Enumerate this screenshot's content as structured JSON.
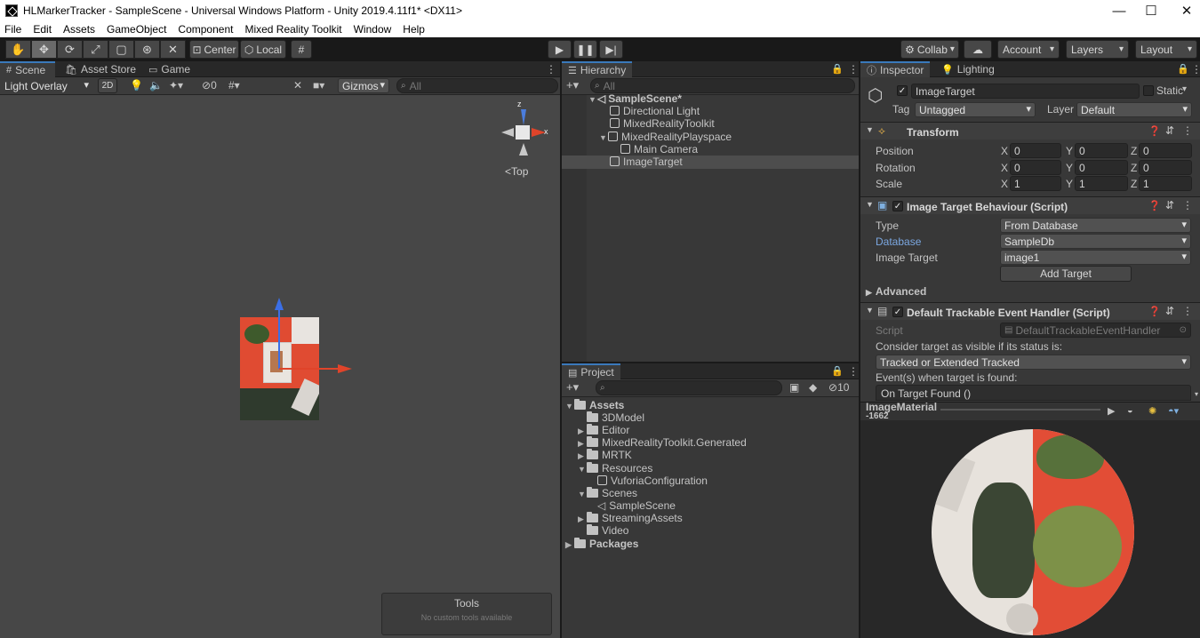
{
  "window": {
    "title": "HLMarkerTracker - SampleScene - Universal Windows Platform - Unity 2019.4.11f1* <DX11>",
    "minimize": "—",
    "maximize": "☐",
    "close": "✕"
  },
  "menu": [
    "File",
    "Edit",
    "Assets",
    "GameObject",
    "Component",
    "Mixed Reality Toolkit",
    "Window",
    "Help"
  ],
  "toolbar": {
    "center_label": "Center",
    "local_label": "Local",
    "collab_label": "Collab",
    "account_label": "Account",
    "layers_label": "Layers",
    "layout_label": "Layout"
  },
  "scene": {
    "tabs": [
      "Scene",
      "Asset Store",
      "Game"
    ],
    "light_overlay": "Light Overlay",
    "mode_2d": "2D",
    "hidden_count": "0",
    "gizmos_label": "Gizmos",
    "search_placeholder": "All",
    "gizmo_y": "z",
    "gizmo_x": "x",
    "view_label": "Top",
    "tools_title": "Tools",
    "tools_subtitle": "No custom tools available"
  },
  "hierarchy": {
    "tab": "Hierarchy",
    "search_placeholder": "All",
    "scene_name": "SampleScene*",
    "items": [
      "Directional Light",
      "MixedRealityToolkit",
      "MixedRealityPlayspace",
      "Main Camera",
      "ImageTarget"
    ]
  },
  "project": {
    "tab": "Project",
    "count": "10",
    "root": "Assets",
    "folders": [
      "3DModel",
      "Editor",
      "MixedRealityToolkit.Generated",
      "MRTK",
      "Resources",
      "VuforiaConfiguration",
      "Scenes",
      "SampleScene",
      "StreamingAssets",
      "Video"
    ],
    "packages": "Packages"
  },
  "inspector": {
    "tabs": [
      "Inspector",
      "Lighting"
    ],
    "object_name": "ImageTarget",
    "static_label": "Static",
    "tag_label": "Tag",
    "tag_value": "Untagged",
    "layer_label": "Layer",
    "layer_value": "Default",
    "transform": {
      "title": "Transform",
      "position_label": "Position",
      "rotation_label": "Rotation",
      "scale_label": "Scale",
      "axis_x": "X",
      "axis_y": "Y",
      "axis_z": "Z",
      "position": [
        "0",
        "0",
        "0"
      ],
      "rotation": [
        "0",
        "0",
        "0"
      ],
      "scale": [
        "1",
        "1",
        "1"
      ]
    },
    "image_target": {
      "title": "Image Target Behaviour (Script)",
      "type_label": "Type",
      "type_value": "From Database",
      "database_label": "Database",
      "database_value": "SampleDb",
      "image_target_label": "Image Target",
      "image_target_value": "image1",
      "add_target": "Add Target",
      "advanced": "Advanced"
    },
    "event_handler": {
      "title": "Default Trackable Event Handler (Script)",
      "script_label": "Script",
      "script_value": "DefaultTrackableEventHandler",
      "consider_label": "Consider target as visible if its status is:",
      "status_value": "Tracked or Extended Tracked",
      "events_label": "Event(s) when target is found:",
      "on_found": "On Target Found ()"
    },
    "preview": {
      "material_name": "ImageMaterial",
      "material_id": "-1662"
    }
  },
  "colors": {
    "accent": "#3a79bb",
    "panel_bg": "#383838",
    "selection": "#4d4d4d",
    "link_label": "#7ba7e0"
  }
}
